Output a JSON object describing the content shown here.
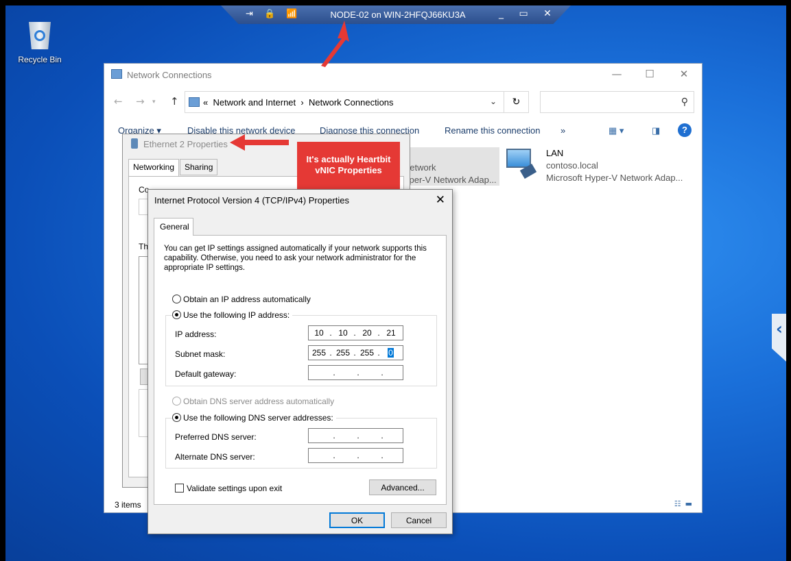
{
  "rdp_bar": {
    "title": "NODE-02 on WIN-2HFQJ66KU3A",
    "left_icons": "⇥ 🔒 📶",
    "right_icons": "_ ▭ ✕"
  },
  "desktop": {
    "recycle_bin_label": "Recycle Bin"
  },
  "network_connections": {
    "title": "Network Connections",
    "address_path_prefix": "«",
    "breadcrumb": [
      "Network and Internet",
      "Network Connections"
    ],
    "breadcrumb_sep": "›",
    "commands": [
      "Organize ▾",
      "Disable this network device",
      "Diagnose this connection",
      "Rename this connection",
      "»"
    ],
    "status_items": "3 items",
    "adapters": [
      {
        "name": "",
        "line2": "network",
        "line3": "yper-V Network Adap..."
      },
      {
        "name": "LAN",
        "line2": "contoso.local",
        "line3": "Microsoft Hyper-V Network Adap..."
      }
    ]
  },
  "ethernet_props": {
    "title": "Ethernet 2 Properties",
    "tabs": [
      "Networking",
      "Sharing"
    ],
    "fragment_connect": "Co",
    "fragment_this": "Th"
  },
  "annotation": {
    "line1": "It's actually Heartbit",
    "line2": "vNIC Properties"
  },
  "ipv4": {
    "title": "Internet Protocol Version 4 (TCP/IPv4) Properties",
    "tab": "General",
    "description": "You can get IP settings assigned automatically if your network supports this capability. Otherwise, you need to ask your network administrator for the appropriate IP settings.",
    "ip_auto_label": "Obtain an IP address automatically",
    "ip_manual_label": "Use the following IP address:",
    "ip_address_label": "IP address:",
    "subnet_label": "Subnet mask:",
    "gateway_label": "Default gateway:",
    "ip_address": [
      "10",
      "10",
      "20",
      "21"
    ],
    "subnet_mask": [
      "255",
      "255",
      "255",
      "0"
    ],
    "dns_auto_label": "Obtain DNS server address automatically",
    "dns_manual_label": "Use the following DNS server addresses:",
    "preferred_dns_label": "Preferred DNS server:",
    "alternate_dns_label": "Alternate DNS server:",
    "validate_label": "Validate settings upon exit",
    "advanced_label": "Advanced...",
    "ok_label": "OK",
    "cancel_label": "Cancel"
  },
  "colors": {
    "annotation_red": "#e53935",
    "selection_blue": "#0078d7"
  }
}
